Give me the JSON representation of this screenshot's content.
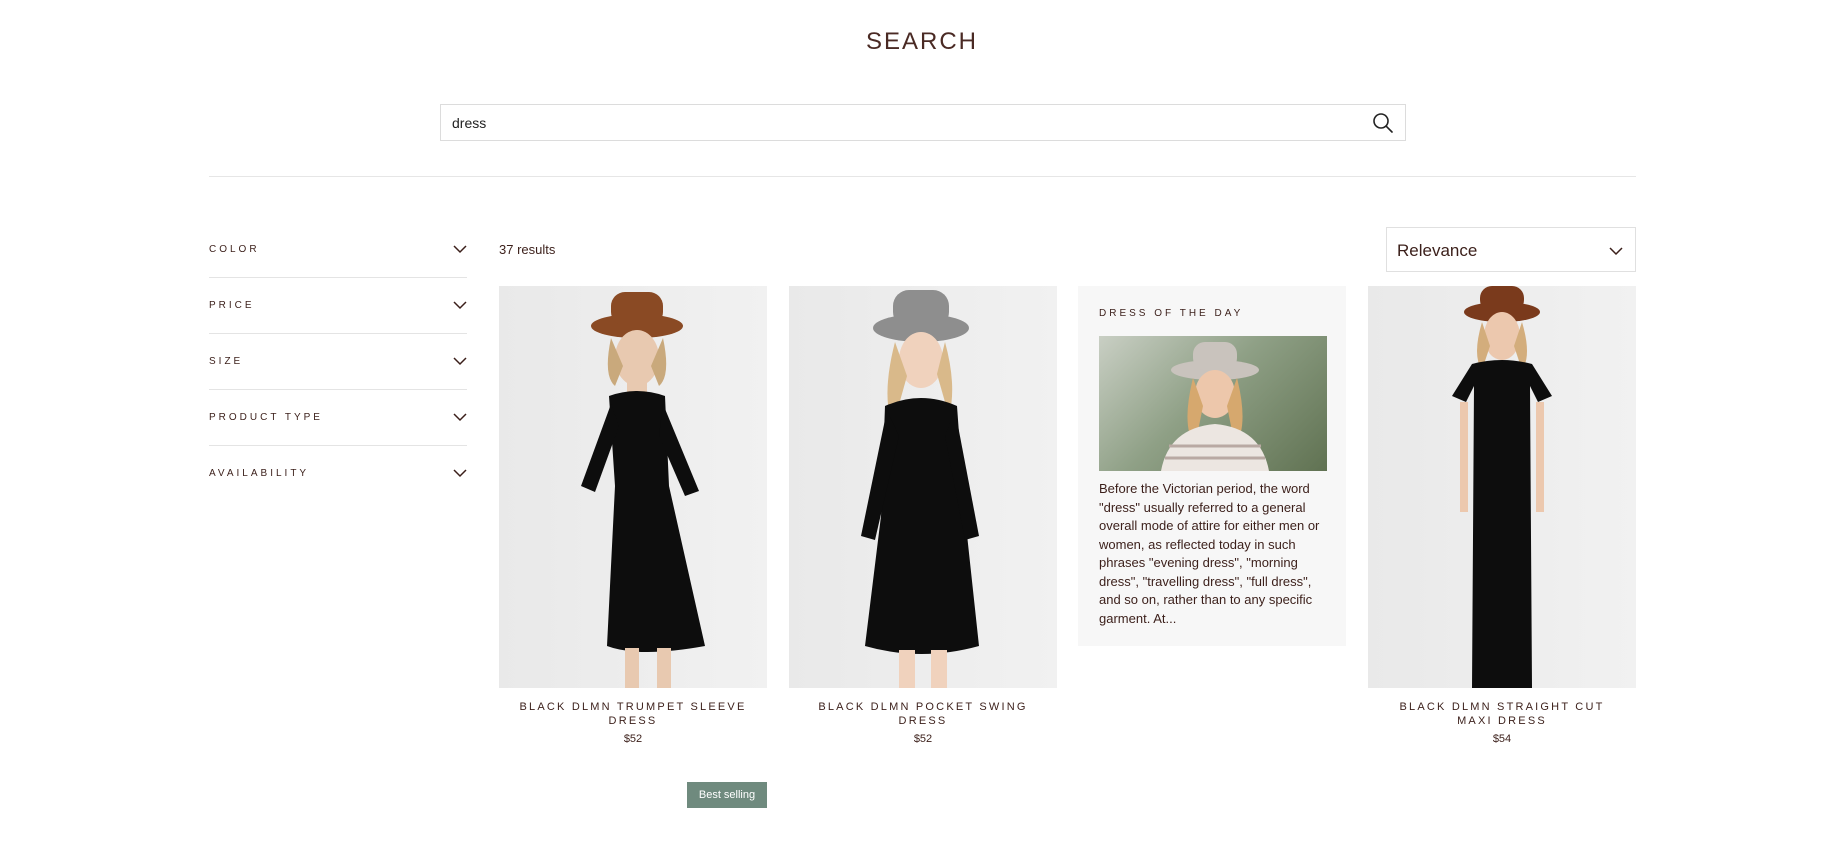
{
  "page": {
    "title": "SEARCH"
  },
  "search": {
    "value": "dress",
    "icon": "search-icon"
  },
  "filters": [
    {
      "label": "COLOR"
    },
    {
      "label": "PRICE"
    },
    {
      "label": "SIZE"
    },
    {
      "label": "PRODUCT TYPE"
    },
    {
      "label": "AVAILABILITY"
    }
  ],
  "results": {
    "count_text": "37 results"
  },
  "sort": {
    "selected": "Relevance"
  },
  "products": [
    {
      "title": "BLACK DLMN TRUMPET SLEEVE DRESS",
      "price": "$52",
      "hat_color": "#8a4a24"
    },
    {
      "title": "BLACK DLMN POCKET SWING DRESS",
      "price": "$52",
      "hat_color": "#8e8e8e"
    },
    {
      "title": "BLACK DLMN STRAIGHT CUT MAXI DRESS",
      "price": "$54",
      "hat_color": "#7a3a1c"
    }
  ],
  "dress_of_the_day": {
    "heading": "DRESS OF THE DAY",
    "text": "Before the Victorian period, the word \"dress\" usually referred to a general overall mode of attire for either men or women, as reflected today in such phrases \"evening dress\", \"morning dress\", \"travelling dress\", \"full dress\", and so on, rather than to any specific garment. At..."
  },
  "badge": {
    "label": "Best selling",
    "color": "#6f8a7e"
  }
}
